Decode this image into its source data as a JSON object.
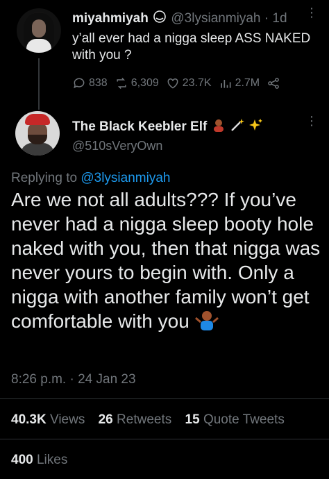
{
  "parent_tweet": {
    "display_name": "miyahmiyah",
    "handle": "@3lysianmiyah",
    "age": "1d",
    "text": "y’all ever had a nigga sleep ASS NAKED with you ?",
    "replies": "838",
    "retweets": "6,309",
    "likes": "23.7K",
    "views": "2.7M"
  },
  "main_tweet": {
    "display_name": "The Black Keebler Elf",
    "handle": "@510sVeryOwn",
    "replying_prefix": "Replying to",
    "replying_handle": "@3lysianmiyah",
    "text": "Are we not all adults??? If you’ve never had a nigga sleep booty hole naked with you, then that nigga was never yours to begin with. Only a nigga with another family won’t get comfortable with you",
    "timestamp": "8:26 p.m. · 24 Jan 23"
  },
  "stats": {
    "views_count": "40.3K",
    "views_label": "Views",
    "retweets_count": "26",
    "retweets_label": "Retweets",
    "quotes_count": "15",
    "quotes_label": "Quote Tweets",
    "likes_count": "400",
    "likes_label": "Likes"
  },
  "colors": {
    "accent": "#1d9bf0",
    "muted": "#71767b",
    "text": "#e7e9ea",
    "background": "#000000"
  }
}
